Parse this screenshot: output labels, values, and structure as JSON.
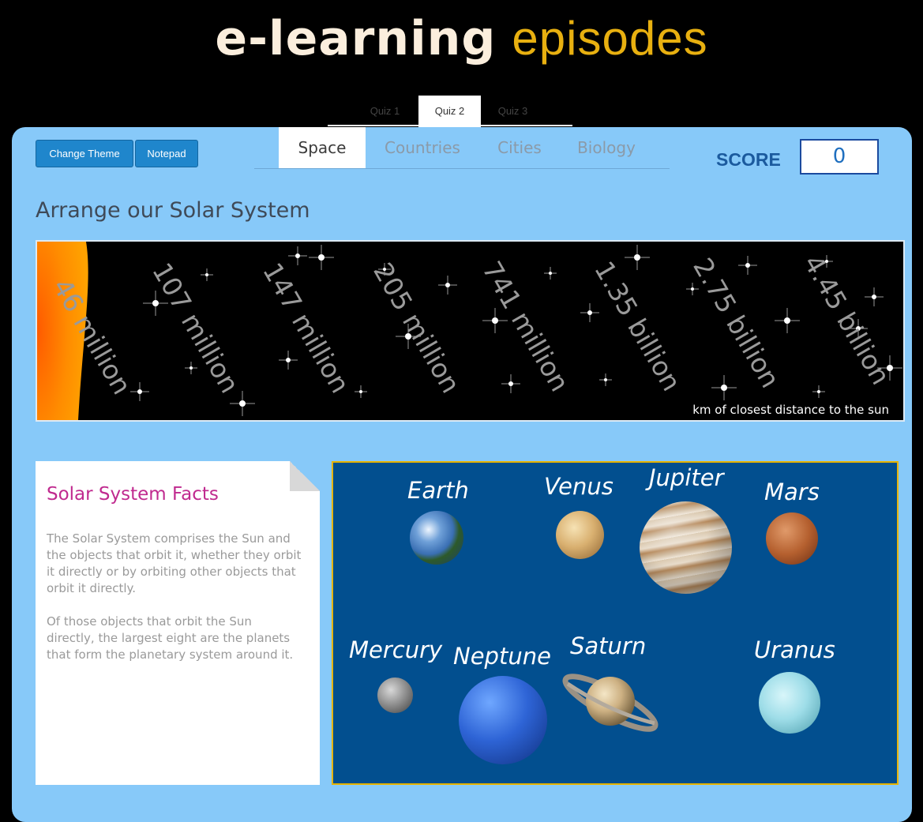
{
  "brand": {
    "part1": "e-learning",
    "part2": "episodes"
  },
  "quiz_tabs": [
    "Quiz 1",
    "Quiz 2",
    "Quiz 3"
  ],
  "quiz_active": "Quiz 2",
  "buttons": {
    "theme": "Change Theme",
    "notepad": "Notepad"
  },
  "subject_tabs": [
    "Space",
    "Countries",
    "Cities",
    "Biology"
  ],
  "subject_active": "Space",
  "score": {
    "label": "SCORE",
    "value": "0"
  },
  "page_title": "Arrange our Solar System",
  "distances": [
    "46 million",
    "107 million",
    "147 million",
    "205 million",
    "741 million",
    "1.35 billion",
    "2.75 billion",
    "4.45 billion"
  ],
  "distance_caption": "km of closest distance to the sun",
  "facts": {
    "title": "Solar System Facts",
    "paragraph1": "The Solar System comprises the Sun and the objects that orbit it, whether they orbit it directly or by orbiting other objects that orbit it directly.",
    "paragraph2": "Of those objects that orbit the Sun directly, the largest eight are the planets that form the planetary system around it."
  },
  "planets": {
    "earth": "Earth",
    "venus": "Venus",
    "jupiter": "Jupiter",
    "mars": "Mars",
    "mercury": "Mercury",
    "neptune": "Neptune",
    "saturn": "Saturn",
    "uranus": "Uranus"
  },
  "colors": {
    "accent_yellow": "#e8b010",
    "panel_blue": "#87c9f9",
    "planet_board": "#024f8f",
    "facts_title": "#c02a8f",
    "button_blue": "#1f86cc",
    "sun_orange": "#ff8c00"
  }
}
